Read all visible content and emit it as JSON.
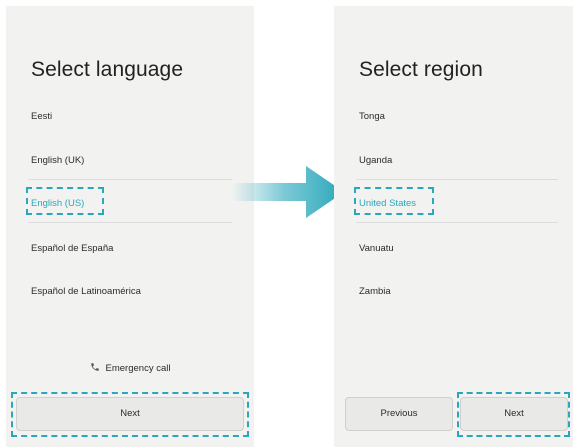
{
  "left_screen": {
    "title": "Select language",
    "items": [
      "Eesti",
      "English (UK)",
      "English (US)",
      "Español de España",
      "Español de Latinoamérica"
    ],
    "selected_index": 2,
    "emergency_label": "Emergency call",
    "next_label": "Next"
  },
  "right_screen": {
    "title": "Select region",
    "items": [
      "Tonga",
      "Uganda",
      "United States",
      "Vanuatu",
      "Zambia"
    ],
    "selected_index": 2,
    "previous_label": "Previous",
    "next_label": "Next"
  },
  "colors": {
    "accent": "#2aa7bb",
    "screen_bg": "#f2f2f1",
    "text": "#2b2b2b"
  },
  "icons": [
    "phone-icon",
    "right-arrow-icon"
  ]
}
